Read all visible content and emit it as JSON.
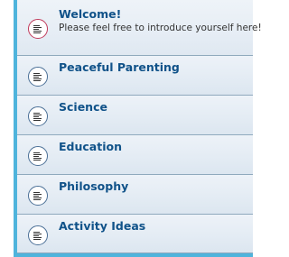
{
  "forums": [
    {
      "title": "Welcome!",
      "description": "Please feel free to introduce yourself here!",
      "icon": "forum-unread-icon"
    },
    {
      "title": "Peaceful Parenting",
      "icon": "forum-read-icon"
    },
    {
      "title": "Science",
      "icon": "forum-read-icon"
    },
    {
      "title": "Education",
      "icon": "forum-read-icon"
    },
    {
      "title": "Philosophy",
      "icon": "forum-read-icon"
    },
    {
      "title": "Activity Ideas",
      "icon": "forum-read-icon"
    }
  ],
  "colors": {
    "frame": "#4fb4dc",
    "title": "#105289",
    "unread_icon": "#c0395a",
    "read_icon": "#4a6f96"
  }
}
